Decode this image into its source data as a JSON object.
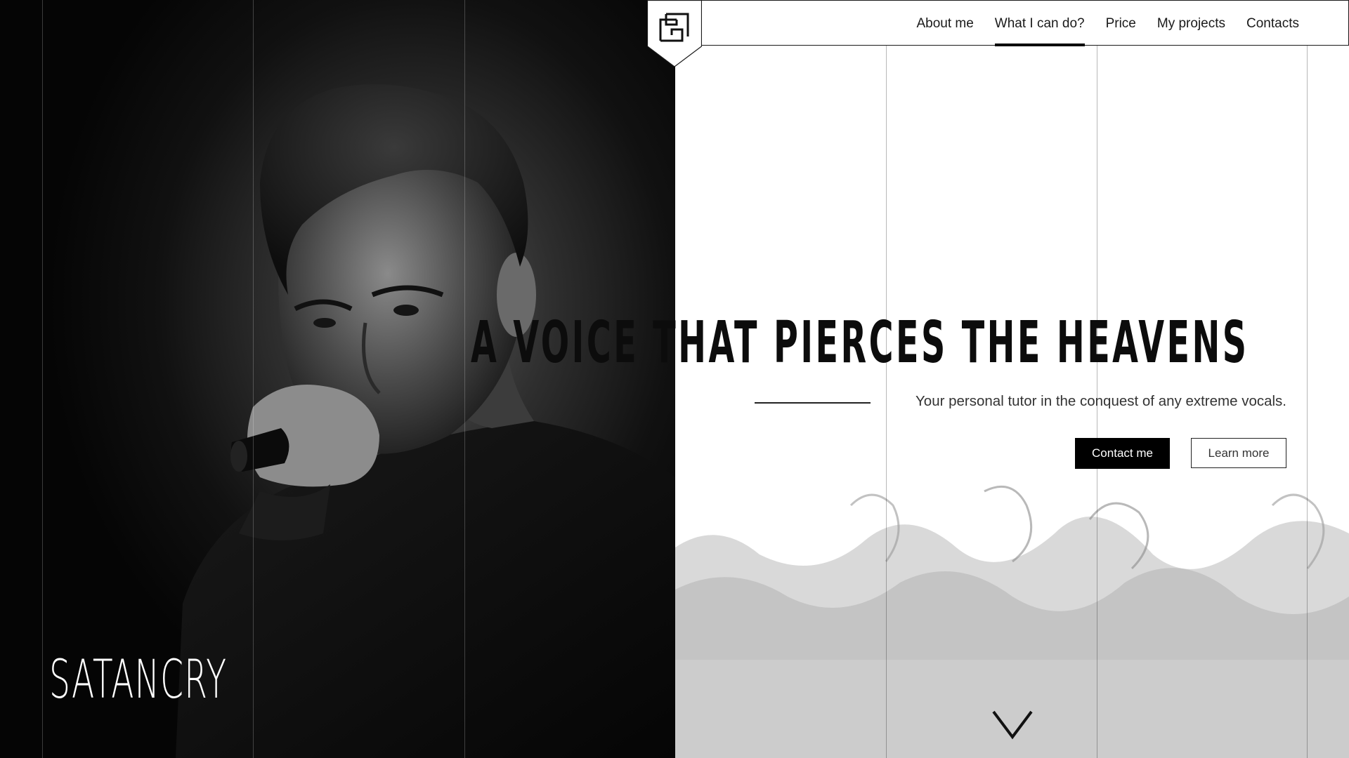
{
  "brand": {
    "name": "SATANCRY",
    "logo_icon": "square-spiral-logo-icon"
  },
  "nav": {
    "items": [
      {
        "label": "About me",
        "active": false
      },
      {
        "label": "What I can do?",
        "active": true
      },
      {
        "label": "Price",
        "active": false
      },
      {
        "label": "My projects",
        "active": false
      },
      {
        "label": "Contacts",
        "active": false
      }
    ]
  },
  "hero": {
    "title": "A VOICE THAT PIERCES THE HEAVENS",
    "subtitle": "Your personal tutor in the conquest of any extreme vocals.",
    "primary_button": "Contact me",
    "secondary_button": "Learn more",
    "scroll_icon": "chevron-down-icon"
  },
  "colors": {
    "accent": "#000000",
    "background": "#ffffff",
    "photo_dark": "#050505",
    "smoke_gray": "#cccccc"
  }
}
